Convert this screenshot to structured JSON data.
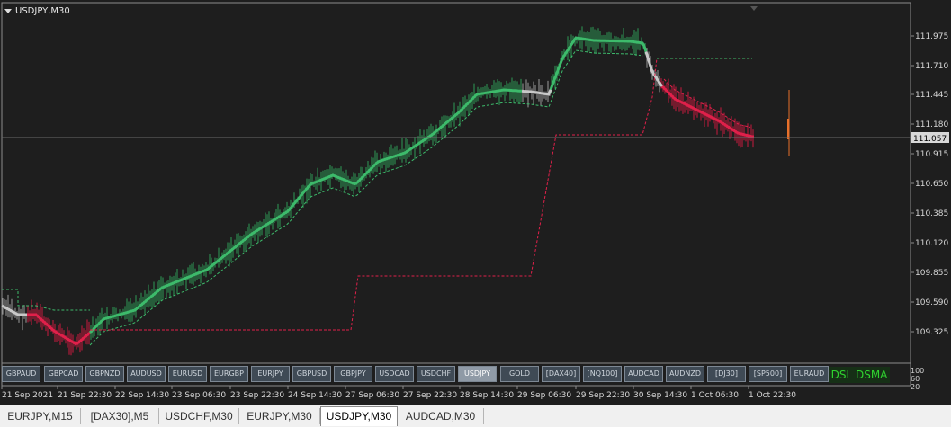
{
  "chart": {
    "title": "USDJPY,M30",
    "price_axis_labels": [
      "111.975",
      "111.710",
      "111.445",
      "111.180",
      "110.915",
      "110.650",
      "110.385",
      "110.120",
      "109.855",
      "109.590",
      "109.325"
    ],
    "current_price": "111.057",
    "time_axis_labels": [
      "21 Sep 2021",
      "21 Sep 22:30",
      "22 Sep 14:30",
      "23 Sep 06:30",
      "23 Sep 22:30",
      "24 Sep 14:30",
      "27 Sep 06:30",
      "27 Sep 22:30",
      "28 Sep 14:30",
      "29 Sep 06:30",
      "29 Sep 22:30",
      "30 Sep 14:30",
      "1 Oct 06:30",
      "1 Oct 22:30"
    ],
    "indicator_scale": [
      "100",
      "60",
      "20"
    ],
    "colors": {
      "background": "#1e1e1e",
      "uptrend": "#3dba6b",
      "downtrend": "#e0204a",
      "neutral": "#c8c8c8",
      "grid": "#3a3a3a"
    }
  },
  "symbols": [
    "GBPAUD",
    "GBPCAD",
    "GBPNZD",
    "AUDUSD",
    "EURUSD",
    "EURGBP",
    "EURJPY",
    "GBPUSD",
    "GBPJPY",
    "USDCAD",
    "USDCHF",
    "USDJPY",
    "GOLD",
    "[DAX40]",
    "[NQ100]",
    "AUDCAD",
    "AUDNZD",
    "[DJ30]",
    "[SP500]",
    "EURAUD"
  ],
  "active_symbol": "USDJPY",
  "indicator_label": "DSL DSMA",
  "tabs": [
    "EURJPY,M15",
    "[DAX30],M5",
    "USDCHF,M30",
    "EURJPY,M30",
    "USDJPY,M30",
    "AUDCAD,M30"
  ],
  "active_tab": "USDJPY,M30"
}
